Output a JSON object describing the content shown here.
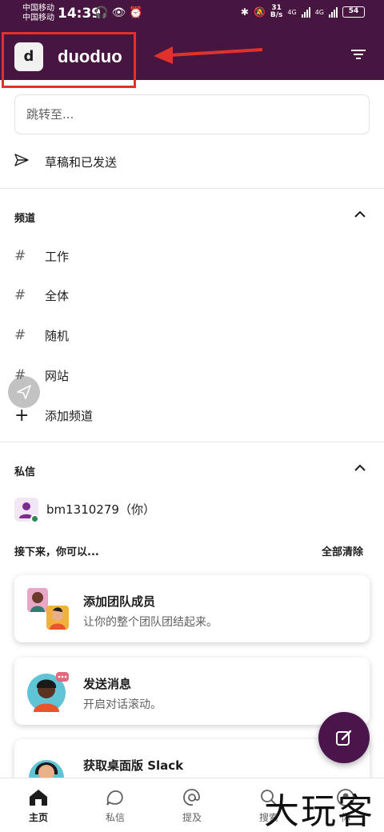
{
  "status_bar": {
    "carrier_1": "中国移动",
    "carrier_2": "中国移动",
    "time": "14:39",
    "speed_value": "31",
    "speed_unit": "B/s",
    "network_1": "4G",
    "network_2": "4G",
    "battery": "54"
  },
  "header": {
    "workspace_initial": "d",
    "workspace_name": "duoduo"
  },
  "search": {
    "placeholder": "跳转至..."
  },
  "drafts": {
    "label": "草稿和已发送"
  },
  "channels": {
    "title": "频道",
    "items": [
      {
        "label": "工作"
      },
      {
        "label": "全体"
      },
      {
        "label": "随机"
      },
      {
        "label": "网站"
      }
    ],
    "add_label": "添加频道"
  },
  "direct_messages": {
    "title": "私信",
    "self_name": "bm1310279（你）"
  },
  "next_steps": {
    "title": "接下来，你可以...",
    "clear_all": "全部清除",
    "cards": [
      {
        "title": "添加团队成员",
        "subtitle": "让你的整个团队团结起来。"
      },
      {
        "title": "发送消息",
        "subtitle": "开启对话滚动。"
      },
      {
        "title": "获取桌面版 Slack",
        "subtitle": ""
      }
    ]
  },
  "bottom_nav": {
    "items": [
      {
        "label": "主页",
        "icon": "home-icon"
      },
      {
        "label": "私信",
        "icon": "messages-icon"
      },
      {
        "label": "提及",
        "icon": "mention-icon"
      },
      {
        "label": "搜索",
        "icon": "search-icon"
      },
      {
        "label": "你",
        "icon": "profile-icon"
      }
    ]
  },
  "watermark": "大玩客",
  "colors": {
    "header_bg": "#461540",
    "fab_bg": "#4a154b",
    "annotation_red": "#e0322b"
  }
}
